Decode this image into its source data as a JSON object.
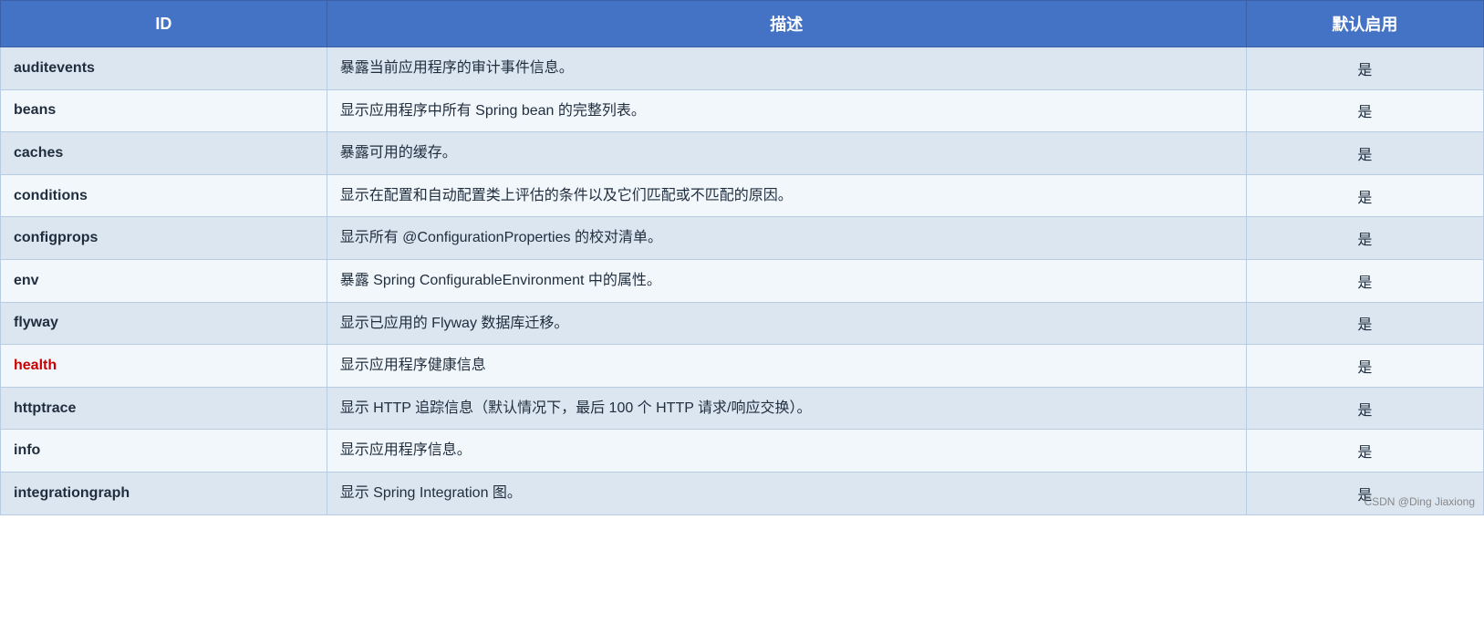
{
  "header": {
    "col_id": "ID",
    "col_desc": "描述",
    "col_default": "默认启用"
  },
  "rows": [
    {
      "id": "auditevents",
      "highlight": false,
      "desc": "暴露当前应用程序的审计事件信息。",
      "default": "是"
    },
    {
      "id": "beans",
      "highlight": false,
      "desc": "显示应用程序中所有 Spring bean 的完整列表。",
      "default": "是"
    },
    {
      "id": "caches",
      "highlight": false,
      "desc": "暴露可用的缓存。",
      "default": "是"
    },
    {
      "id": "conditions",
      "highlight": false,
      "desc": "显示在配置和自动配置类上评估的条件以及它们匹配或不匹配的原因。",
      "default": "是"
    },
    {
      "id": "configprops",
      "highlight": false,
      "desc": "显示所有 @ConfigurationProperties 的校对清单。",
      "default": "是"
    },
    {
      "id": "env",
      "highlight": false,
      "desc": "暴露 Spring ConfigurableEnvironment 中的属性。",
      "default": "是"
    },
    {
      "id": "flyway",
      "highlight": false,
      "desc": "显示已应用的 Flyway 数据库迁移。",
      "default": "是"
    },
    {
      "id": "health",
      "highlight": true,
      "desc": "显示应用程序健康信息",
      "default": "是"
    },
    {
      "id": "httptrace",
      "highlight": false,
      "desc": "显示 HTTP 追踪信息（默认情况下，最后 100 个 HTTP 请求/响应交换）。",
      "default": "是"
    },
    {
      "id": "info",
      "highlight": false,
      "desc": "显示应用程序信息。",
      "default": "是"
    },
    {
      "id": "integrationgraph",
      "highlight": false,
      "desc": "显示 Spring Integration 图。",
      "default": "是"
    }
  ],
  "watermark": "CSDN @Ding Jiaxiong"
}
